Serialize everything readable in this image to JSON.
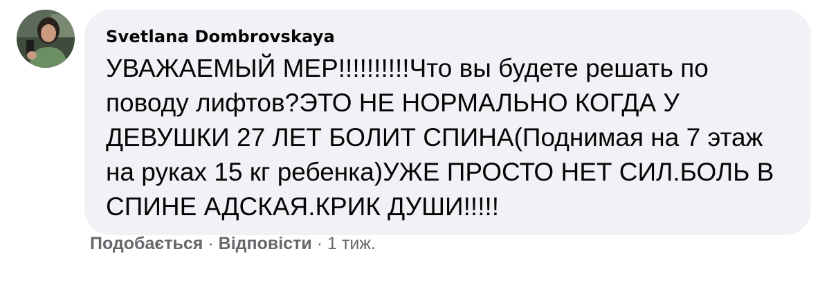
{
  "comment": {
    "author": "Svetlana Dombrovskaya",
    "text": "УВАЖАЕМЫЙ МЕР!!!!!!!!!!Что вы будете решать по поводу лифтов?ЭТО НЕ НОРМАЛЬНО КОГДА У ДЕВУШКИ 27 ЛЕТ БОЛИТ СПИНА(Поднимая на 7 этаж на руках 15 кг ребенка)УЖЕ ПРОСТО НЕТ СИЛ.БОЛЬ В СПИНЕ АДСКАЯ.КРИК ДУШИ!!!!!",
    "actions": {
      "like_label": "Подобається",
      "separator": "·",
      "reply_label": "Відповісти",
      "timestamp": "1 тиж."
    }
  },
  "colors": {
    "bubble_background": "#f0f2f5",
    "text_primary": "#050505",
    "text_secondary": "#65676b"
  },
  "icons": {
    "avatar": "user-profile-photo"
  }
}
